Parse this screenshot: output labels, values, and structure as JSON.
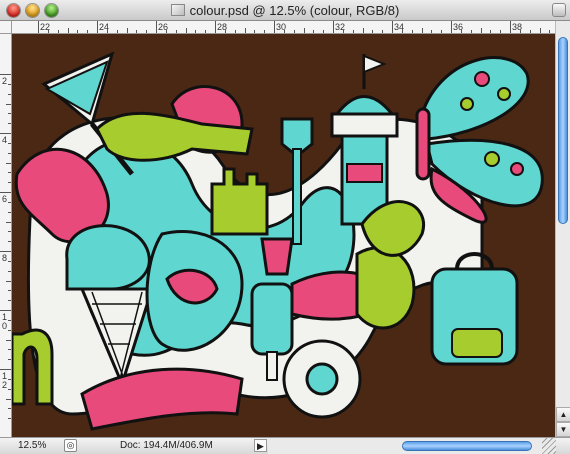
{
  "window": {
    "title": "colour.psd @ 12.5% (colour, RGB/8)"
  },
  "rulers": {
    "top_labels": [
      "22",
      "24",
      "26",
      "28",
      "30",
      "32",
      "34",
      "36",
      "38"
    ],
    "left_labels": [
      "2",
      "4",
      "6",
      "8",
      "1\n0",
      "1\n2"
    ]
  },
  "canvas": {
    "background_color": "#4a2814",
    "accent_colors": {
      "cyan": "#5fd6d0",
      "pink": "#e84a7c",
      "lime": "#a6cc2e",
      "white": "#f2f2ee"
    }
  },
  "statusbar": {
    "zoom_value": "12.5%",
    "doc_info": "Doc: 194.4M/406.9M",
    "arrow_label": "▶"
  },
  "scroll": {
    "up_arrow": "▲",
    "down_arrow": "▼"
  }
}
